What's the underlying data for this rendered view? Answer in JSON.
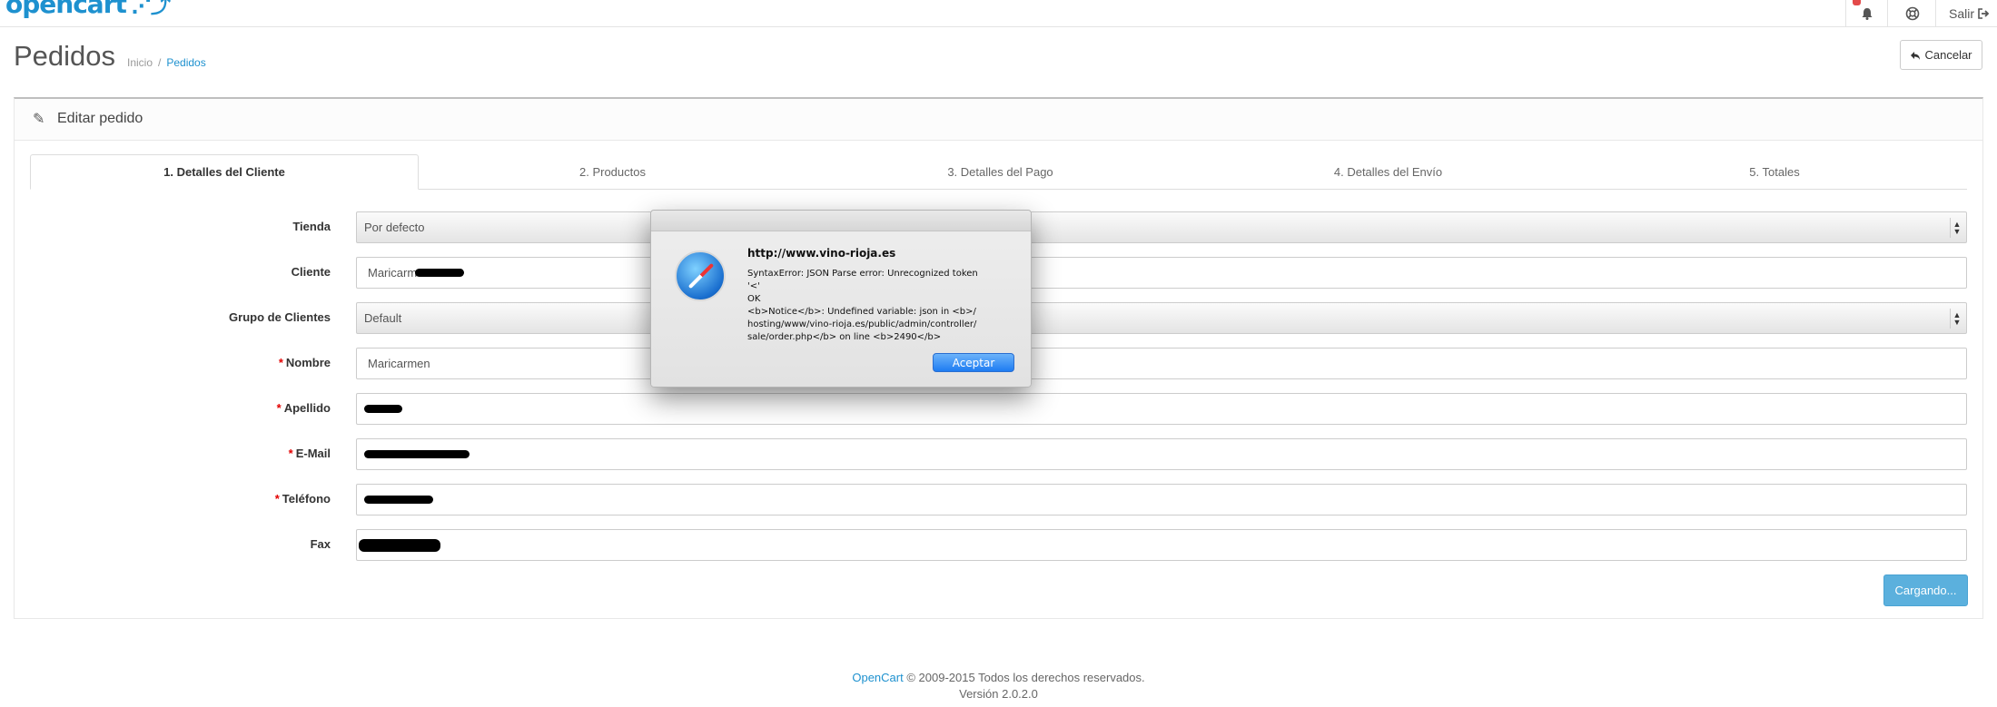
{
  "header": {
    "logo_text": "opencart",
    "logo_cart": "⋰⤴",
    "logout_label": "Salir"
  },
  "page": {
    "title": "Pedidos",
    "breadcrumb": [
      "Inicio",
      "Pedidos"
    ],
    "cancel_label": "Cancelar"
  },
  "panel": {
    "title": "Editar pedido",
    "tabs": [
      {
        "label": "1. Detalles del Cliente",
        "active": true
      },
      {
        "label": "2. Productos"
      },
      {
        "label": "3. Detalles del Pago"
      },
      {
        "label": "4. Detalles del Envío"
      },
      {
        "label": "5. Totales"
      }
    ]
  },
  "form": {
    "store": {
      "label": "Tienda",
      "value": "Por defecto"
    },
    "customer": {
      "label": "Cliente",
      "value": "Maricarm"
    },
    "customer_group": {
      "label": "Grupo de Clientes",
      "value": "Default"
    },
    "firstname": {
      "label": "Nombre",
      "value": "Maricarmen",
      "required": "*"
    },
    "lastname": {
      "label": "Apellido",
      "required": "*"
    },
    "email": {
      "label": "E-Mail",
      "required": "*"
    },
    "telephone": {
      "label": "Teléfono",
      "required": "*"
    },
    "fax": {
      "label": "Fax"
    },
    "loading_label": "Cargando..."
  },
  "dialog": {
    "title": "http://www.vino-rioja.es",
    "message": "SyntaxError: JSON Parse error: Unrecognized token\n'<'\nOK\n<b>Notice</b>: Undefined variable: json in <b>/\nhosting/www/vino-rioja.es/public/admin/controller/\nsale/order.php</b> on line <b>2490</b>",
    "accept_label": "Aceptar"
  },
  "footer": {
    "link": "OpenCart",
    "copyright": " © 2009-2015 Todos los derechos reservados.",
    "version": "Versión 2.0.2.0"
  }
}
